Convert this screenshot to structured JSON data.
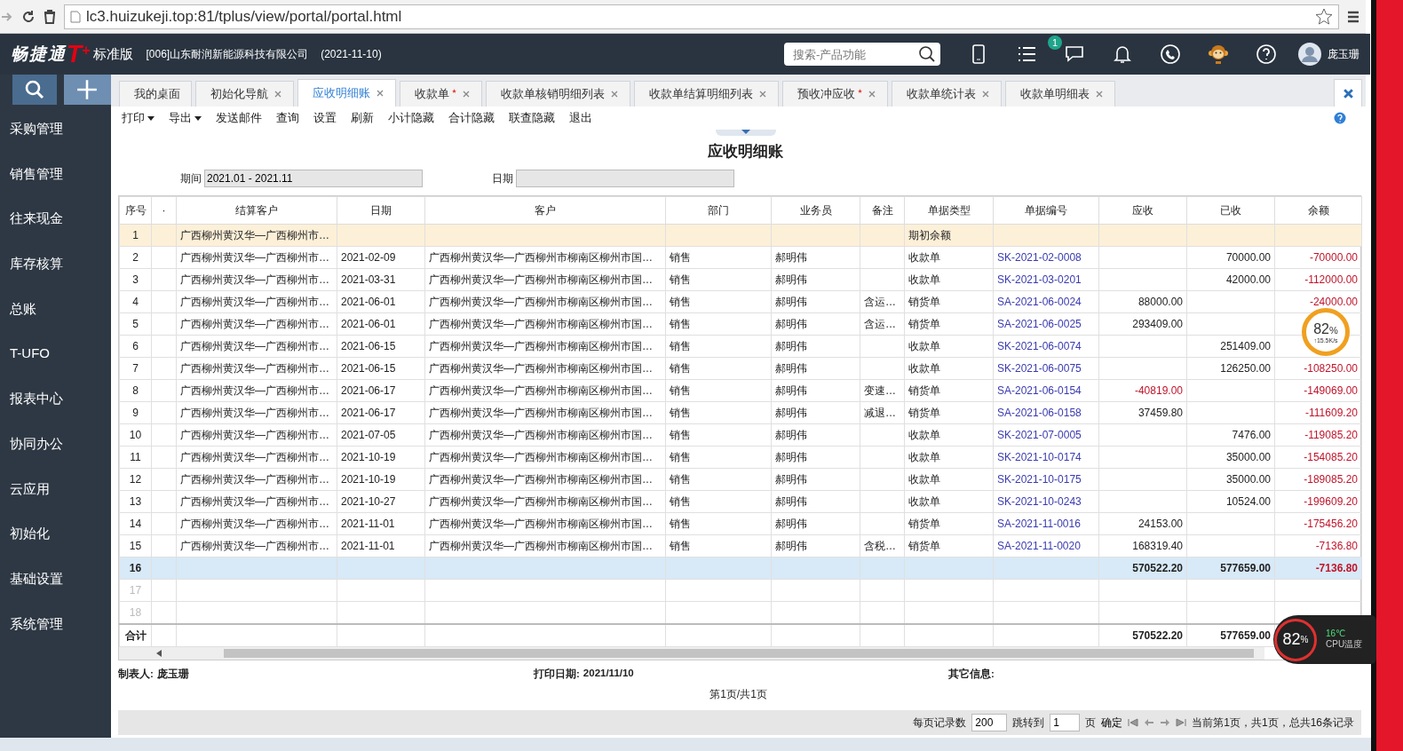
{
  "browser": {
    "url": "lc3.huizukeji.top:81/tplus/view/portal/portal.html"
  },
  "header": {
    "logo": "畅捷通",
    "logo_mark": "T",
    "logo_plus": "+",
    "edition": "标准版",
    "company": "[006]山东耐润新能源科技有限公司",
    "date": "(2021-11-10)",
    "search": {
      "placeholder": "搜索-产品功能"
    },
    "message_badge": "1",
    "user": "庞玉珊"
  },
  "sidebar": {
    "items": [
      {
        "label": "采购管理"
      },
      {
        "label": "销售管理"
      },
      {
        "label": "往来现金"
      },
      {
        "label": "库存核算"
      },
      {
        "label": "总账"
      },
      {
        "label": "T-UFO"
      },
      {
        "label": "报表中心"
      },
      {
        "label": "协同办公"
      },
      {
        "label": "云应用"
      },
      {
        "label": "初始化"
      },
      {
        "label": "基础设置"
      },
      {
        "label": "系统管理"
      }
    ]
  },
  "tabs": [
    {
      "label": "我的桌面",
      "modified": false,
      "closable": false,
      "selected": false
    },
    {
      "label": "初始化导航",
      "modified": false,
      "closable": true,
      "selected": false
    },
    {
      "label": "应收明细账",
      "modified": false,
      "closable": true,
      "selected": true
    },
    {
      "label": "收款单",
      "modified": true,
      "closable": true,
      "selected": false
    },
    {
      "label": "收款单核销明细列表",
      "modified": false,
      "closable": true,
      "selected": false
    },
    {
      "label": "收款单结算明细列表",
      "modified": false,
      "closable": true,
      "selected": false
    },
    {
      "label": "预收冲应收",
      "modified": true,
      "closable": true,
      "selected": false
    },
    {
      "label": "收款单统计表",
      "modified": false,
      "closable": true,
      "selected": false
    },
    {
      "label": "收款单明细表",
      "modified": false,
      "closable": true,
      "selected": false
    }
  ],
  "toolbar": [
    {
      "label": "打印",
      "dropdown": true
    },
    {
      "label": "导出",
      "dropdown": true
    },
    {
      "label": "发送邮件",
      "dropdown": false
    },
    {
      "label": "查询",
      "dropdown": false
    },
    {
      "label": "设置",
      "dropdown": false
    },
    {
      "label": "刷新",
      "dropdown": false
    },
    {
      "label": "小计隐藏",
      "dropdown": false
    },
    {
      "label": "合计隐藏",
      "dropdown": false
    },
    {
      "label": "联查隐藏",
      "dropdown": false
    },
    {
      "label": "退出",
      "dropdown": false
    }
  ],
  "report": {
    "title": "应收明细账",
    "filters": [
      {
        "label": "期间",
        "value": "2021.01 - 2021.11"
      },
      {
        "label": "日期"
      }
    ]
  },
  "table": {
    "columns": [
      "序号",
      "·",
      "结算客户",
      "日期",
      "客户",
      "部门",
      "业务员",
      "备注",
      "单据类型",
      "单据编号",
      "应收",
      "已收",
      "余额"
    ],
    "rows": [
      {
        "kind": "opening",
        "selected": false,
        "cells": [
          "1",
          "",
          "广西柳州黄汉华—广西柳州市…",
          "",
          "",
          "",
          "",
          "",
          "期初余额",
          "",
          "",
          "",
          ""
        ]
      },
      {
        "kind": "entry",
        "selected": false,
        "cells": [
          "2",
          "",
          "广西柳州黄汉华—广西柳州市…",
          "2021-02-09",
          "广西柳州黄汉华—广西柳州市柳南区柳州市国…",
          "销售",
          "郝明伟",
          "",
          "收款单",
          "SK-2021-02-0008",
          "",
          "70000.00",
          "-70000.00"
        ]
      },
      {
        "kind": "entry",
        "selected": false,
        "cells": [
          "3",
          "",
          "广西柳州黄汉华—广西柳州市…",
          "2021-03-31",
          "广西柳州黄汉华—广西柳州市柳南区柳州市国…",
          "销售",
          "郝明伟",
          "",
          "收款单",
          "SK-2021-03-0201",
          "",
          "42000.00",
          "-112000.00"
        ]
      },
      {
        "kind": "entry",
        "selected": false,
        "cells": [
          "4",
          "",
          "广西柳州黄汉华—广西柳州市…",
          "2021-06-01",
          "广西柳州黄汉华—广西柳州市柳南区柳州市国…",
          "销售",
          "郝明伟",
          "含运…",
          "销货单",
          "SA-2021-06-0024",
          "88000.00",
          "",
          "-24000.00"
        ]
      },
      {
        "kind": "entry",
        "selected": false,
        "cells": [
          "5",
          "",
          "广西柳州黄汉华—广西柳州市…",
          "2021-06-01",
          "广西柳州黄汉华—广西柳州市柳南区柳州市国…",
          "销售",
          "郝明伟",
          "含运…",
          "销货单",
          "SA-2021-06-0025",
          "293409.00",
          "",
          ""
        ]
      },
      {
        "kind": "entry",
        "selected": false,
        "cells": [
          "6",
          "",
          "广西柳州黄汉华—广西柳州市…",
          "2021-06-15",
          "广西柳州黄汉华—广西柳州市柳南区柳州市国…",
          "销售",
          "郝明伟",
          "",
          "收款单",
          "SK-2021-06-0074",
          "",
          "251409.00",
          ""
        ]
      },
      {
        "kind": "entry",
        "selected": false,
        "cells": [
          "7",
          "",
          "广西柳州黄汉华—广西柳州市…",
          "2021-06-15",
          "广西柳州黄汉华—广西柳州市柳南区柳州市国…",
          "销售",
          "郝明伟",
          "",
          "收款单",
          "SK-2021-06-0075",
          "",
          "126250.00",
          "-108250.00"
        ]
      },
      {
        "kind": "entry",
        "selected": false,
        "cells": [
          "8",
          "",
          "广西柳州黄汉华—广西柳州市…",
          "2021-06-17",
          "广西柳州黄汉华—广西柳州市柳南区柳州市国…",
          "销售",
          "郝明伟",
          "变速…",
          "销货单",
          "SA-2021-06-0154",
          "-40819.00",
          "",
          "-149069.00"
        ]
      },
      {
        "kind": "entry",
        "selected": false,
        "cells": [
          "9",
          "",
          "广西柳州黄汉华—广西柳州市…",
          "2021-06-17",
          "广西柳州黄汉华—广西柳州市柳南区柳州市国…",
          "销售",
          "郝明伟",
          "减退…",
          "销货单",
          "SA-2021-06-0158",
          "37459.80",
          "",
          "-111609.20"
        ]
      },
      {
        "kind": "entry",
        "selected": false,
        "cells": [
          "10",
          "",
          "广西柳州黄汉华—广西柳州市…",
          "2021-07-05",
          "广西柳州黄汉华—广西柳州市柳南区柳州市国…",
          "销售",
          "郝明伟",
          "",
          "收款单",
          "SK-2021-07-0005",
          "",
          "7476.00",
          "-119085.20"
        ]
      },
      {
        "kind": "entry",
        "selected": false,
        "cells": [
          "11",
          "",
          "广西柳州黄汉华—广西柳州市…",
          "2021-10-19",
          "广西柳州黄汉华—广西柳州市柳南区柳州市国…",
          "销售",
          "郝明伟",
          "",
          "收款单",
          "SK-2021-10-0174",
          "",
          "35000.00",
          "-154085.20"
        ]
      },
      {
        "kind": "entry",
        "selected": false,
        "cells": [
          "12",
          "",
          "广西柳州黄汉华—广西柳州市…",
          "2021-10-19",
          "广西柳州黄汉华—广西柳州市柳南区柳州市国…",
          "销售",
          "郝明伟",
          "",
          "收款单",
          "SK-2021-10-0175",
          "",
          "35000.00",
          "-189085.20"
        ]
      },
      {
        "kind": "entry",
        "selected": false,
        "cells": [
          "13",
          "",
          "广西柳州黄汉华—广西柳州市…",
          "2021-10-27",
          "广西柳州黄汉华—广西柳州市柳南区柳州市国…",
          "销售",
          "郝明伟",
          "",
          "收款单",
          "SK-2021-10-0243",
          "",
          "10524.00",
          "-199609.20"
        ]
      },
      {
        "kind": "entry",
        "selected": false,
        "cells": [
          "14",
          "",
          "广西柳州黄汉华—广西柳州市…",
          "2021-11-01",
          "广西柳州黄汉华—广西柳州市柳南区柳州市国…",
          "销售",
          "郝明伟",
          "",
          "销货单",
          "SA-2021-11-0016",
          "24153.00",
          "",
          "-175456.20"
        ]
      },
      {
        "kind": "entry",
        "selected": false,
        "cells": [
          "15",
          "",
          "广西柳州黄汉华—广西柳州市…",
          "2021-11-01",
          "广西柳州黄汉华—广西柳州市柳南区柳州市国…",
          "销售",
          "郝明伟",
          "含税…",
          "销货单",
          "SA-2021-11-0020",
          "168319.40",
          "",
          "-7136.80"
        ]
      },
      {
        "kind": "subtotal",
        "selected": true,
        "cells": [
          "16",
          "",
          "",
          "",
          "",
          "",
          "",
          "",
          "",
          "",
          "570522.20",
          "577659.00",
          "-7136.80"
        ]
      },
      {
        "kind": "blank",
        "selected": false,
        "cells": [
          "17",
          "",
          "",
          "",
          "",
          "",
          "",
          "",
          "",
          "",
          "",
          "",
          ""
        ]
      },
      {
        "kind": "blank",
        "selected": false,
        "cells": [
          "18",
          "",
          "",
          "",
          "",
          "",
          "",
          "",
          "",
          "",
          "",
          "",
          ""
        ]
      }
    ],
    "total": {
      "label": "合计",
      "receivable": "570522.20",
      "received": "577659.00"
    }
  },
  "report_footer": {
    "maker_label": "制表人:",
    "maker": "庞玉珊",
    "print_date_label": "打印日期:",
    "print_date": "2021/11/10",
    "other_label": "其它信息:",
    "page": "第1页/共1页"
  },
  "pager": {
    "per_page_label": "每页记录数",
    "per_page": "200",
    "goto_label": "跳转到",
    "goto": "1",
    "page_unit": "页",
    "confirm": "确定",
    "summary": "当前第1页，共1页，总共16条记录"
  },
  "widgets": {
    "speed": {
      "percent": "82",
      "unit": "%",
      "rate": "↑15.5K/s"
    },
    "cpu": {
      "percent": "82",
      "unit": "%",
      "temp": "16℃",
      "label": "CPU温度"
    }
  }
}
